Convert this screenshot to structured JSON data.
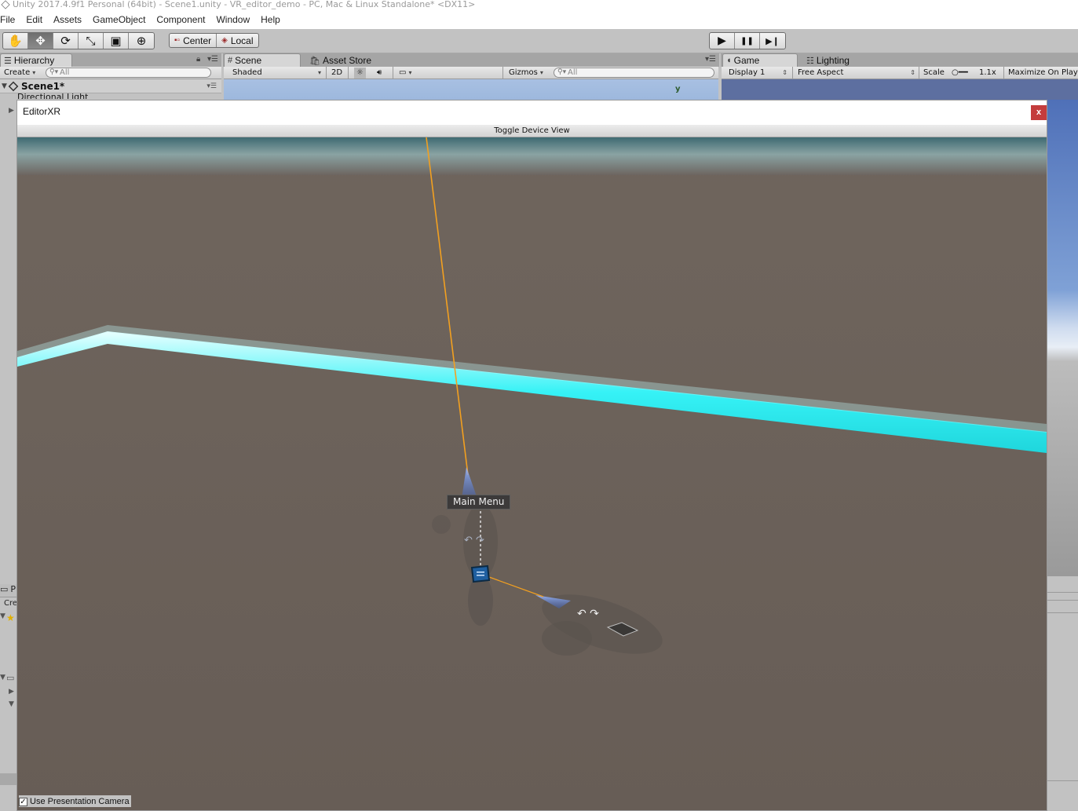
{
  "window": {
    "title": "Unity 2017.4.9f1 Personal (64bit) - Scene1.unity - VR_editor_demo - PC, Mac & Linux Standalone* <DX11>"
  },
  "menubar": {
    "items": [
      "File",
      "Edit",
      "Assets",
      "GameObject",
      "Component",
      "Window",
      "Help"
    ]
  },
  "toolbar": {
    "tools": [
      {
        "name": "hand-tool",
        "icon": "hand-icon",
        "glyph": "✋"
      },
      {
        "name": "move-tool",
        "icon": "move-icon",
        "glyph": "✥"
      },
      {
        "name": "rotate-tool",
        "icon": "rotate-icon",
        "glyph": "⟳"
      },
      {
        "name": "scale-tool",
        "icon": "scale-icon",
        "glyph": "⤡"
      },
      {
        "name": "rect-tool",
        "icon": "rect-icon",
        "glyph": "▣"
      },
      {
        "name": "transform-tool",
        "icon": "transform-icon",
        "glyph": "⊕"
      }
    ],
    "pivot_mode": "Center",
    "pivot_rotation": "Local",
    "play": {
      "play": "▶",
      "pause": "❚❚",
      "step": "▶❙"
    }
  },
  "hierarchy": {
    "tab_label": "Hierarchy",
    "create_label": "Create",
    "search_placeholder": "All",
    "scene_name": "Scene1*",
    "partial_item": "Directional Light"
  },
  "scene": {
    "tab_label": "Scene",
    "asset_store_label": "Asset Store",
    "shading_mode": "Shaded",
    "mode_2d": "2D",
    "gizmos_label": "Gizmos",
    "search_placeholder": "All",
    "axis_label": "y"
  },
  "game": {
    "tab_label": "Game",
    "lighting_label": "Lighting",
    "display": "Display 1",
    "aspect": "Free Aspect",
    "scale_label": "Scale",
    "scale_value": "1.1x",
    "maximize_label": "Maximize On Play"
  },
  "project_peek": {
    "tab_label": "P",
    "create_label": "Cre"
  },
  "editorxr": {
    "title": "EditorXR",
    "close_label": "x",
    "toggle_label": "Toggle Device View",
    "main_menu_label": "Main Menu",
    "presentation_camera_label": "Use Presentation Camera",
    "presentation_camera_checked": true
  },
  "colors": {
    "floor": "#6a6059",
    "boundary": "#2ee8ee",
    "ray": "#f2a020",
    "sky_top": "#3e6a72",
    "close_button": "#c43c3c"
  }
}
